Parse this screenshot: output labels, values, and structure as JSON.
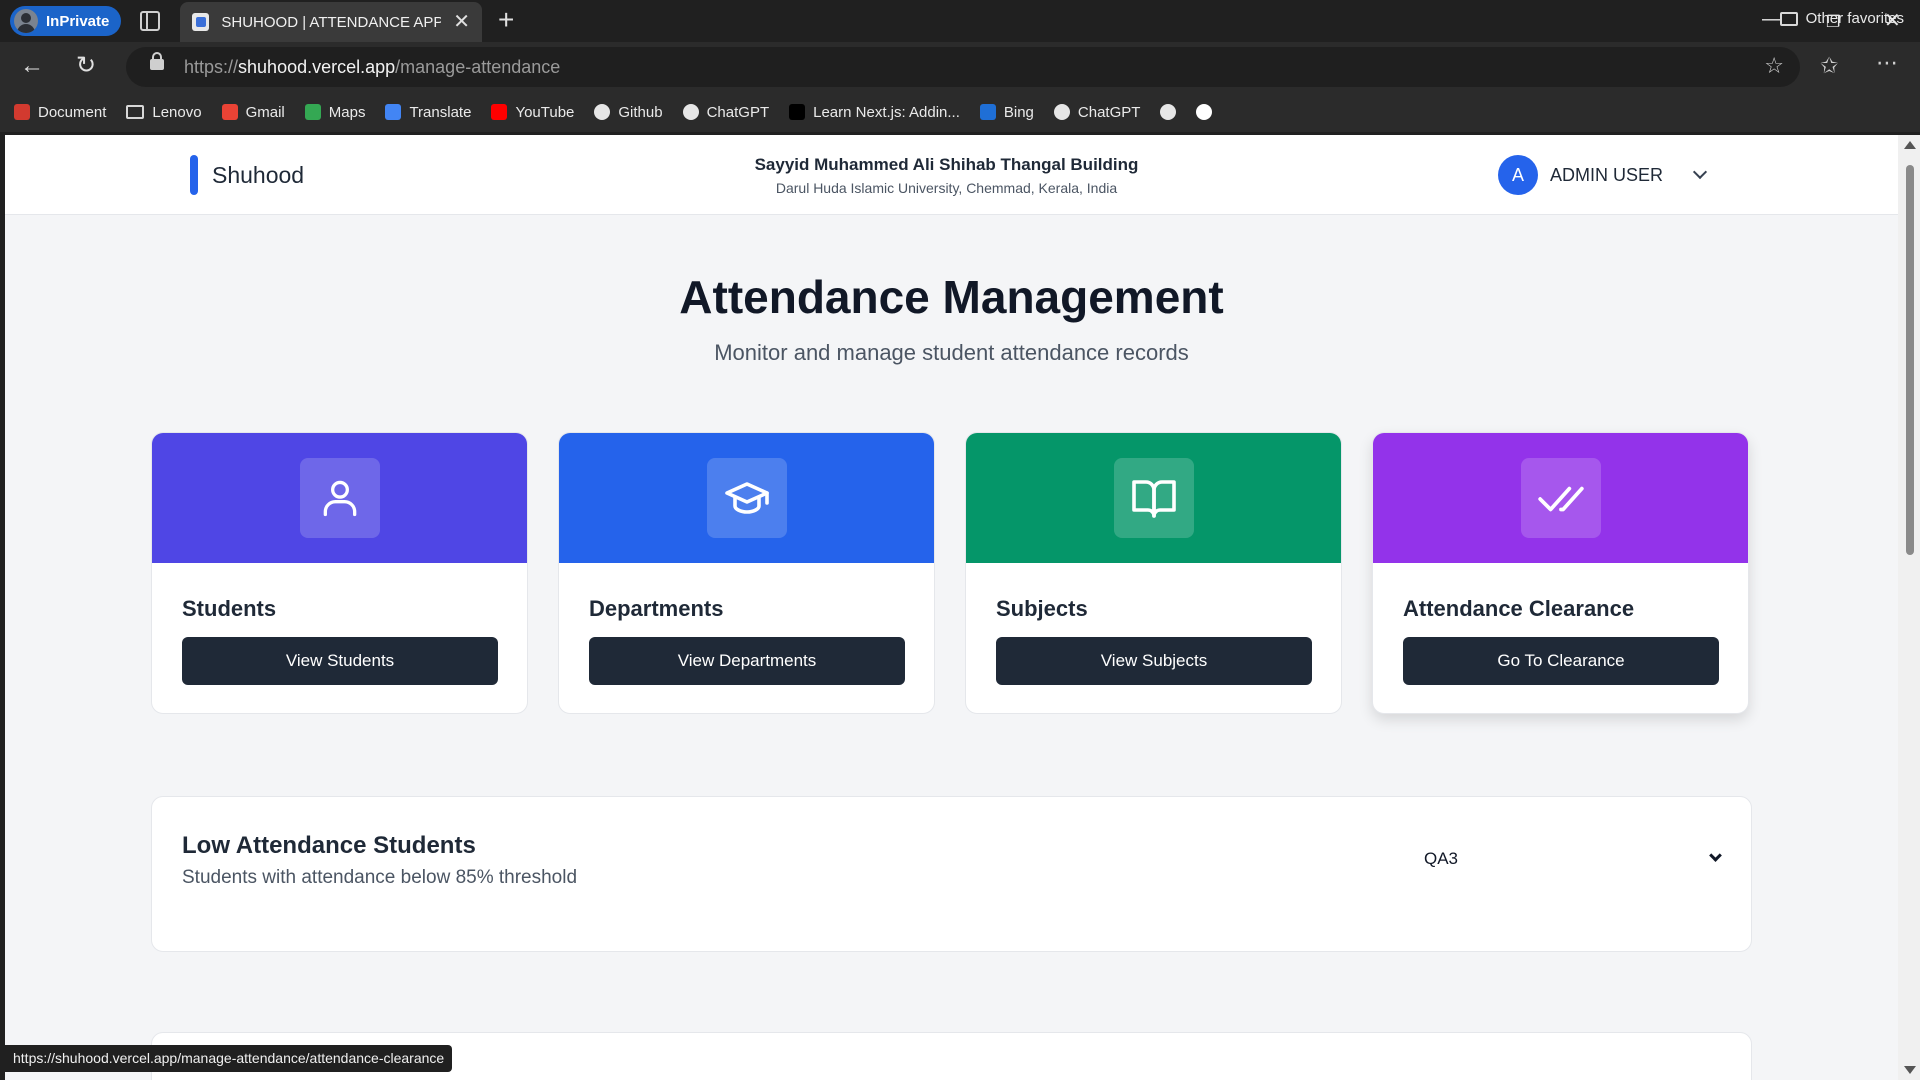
{
  "browser": {
    "inprivate_label": "InPrivate",
    "tab_title": "SHUHOOD | ATTENDANCE APPLIC",
    "url_scheme": "https://",
    "url_host": "shuhood.vercel.app",
    "url_path": "/manage-attendance",
    "bookmarks": [
      {
        "label": "Document",
        "icon": "document-icon",
        "color": "#d23a2f"
      },
      {
        "label": "Lenovo",
        "icon": "folder-icon",
        "color": "#d8d8d8"
      },
      {
        "label": "Gmail",
        "icon": "gmail-icon",
        "color": "#ea4335"
      },
      {
        "label": "Maps",
        "icon": "maps-icon",
        "color": "#34a853"
      },
      {
        "label": "Translate",
        "icon": "translate-icon",
        "color": "#4285f4"
      },
      {
        "label": "YouTube",
        "icon": "youtube-icon",
        "color": "#ff0000"
      },
      {
        "label": "Github",
        "icon": "github-icon",
        "color": "#e6e6e6"
      },
      {
        "label": "ChatGPT",
        "icon": "chatgpt-icon",
        "color": "#e6e6e6"
      },
      {
        "label": "Learn Next.js: Addin...",
        "icon": "nextjs-icon",
        "color": "#000000"
      },
      {
        "label": "Bing",
        "icon": "bing-icon",
        "color": "#1f6fd6"
      },
      {
        "label": "ChatGPT",
        "icon": "chatgpt-icon",
        "color": "#e6e6e6"
      },
      {
        "label": "",
        "icon": "github-icon",
        "color": "#e6e6e6"
      },
      {
        "label": "",
        "icon": "vercel-icon",
        "color": "#ffffff"
      }
    ],
    "other_favorites": "Other favorites",
    "status_url": "https://shuhood.vercel.app/manage-attendance/attendance-clearance"
  },
  "header": {
    "brand": "Shuhood",
    "building_name": "Sayyid Muhammed Ali Shihab Thangal Building",
    "building_address": "Darul Huda Islamic University, Chemmad, Kerala, India",
    "user_initial": "A",
    "user_name": "ADMIN USER"
  },
  "main": {
    "title": "Attendance Management",
    "subtitle": "Monitor and manage student attendance records",
    "cards": [
      {
        "label": "Students",
        "button": "View Students",
        "color": "#4f46e5",
        "icon": "user-icon"
      },
      {
        "label": "Departments",
        "button": "View Departments",
        "color": "#2563eb",
        "icon": "graduation-cap-icon"
      },
      {
        "label": "Subjects",
        "button": "View Subjects",
        "color": "#059669",
        "icon": "book-open-icon"
      },
      {
        "label": "Attendance Clearance",
        "button": "Go To Clearance",
        "color": "#9333ea",
        "icon": "double-check-icon"
      }
    ]
  },
  "low_attendance": {
    "title": "Low Attendance Students",
    "subtitle": "Students with attendance below 85% threshold",
    "selected_class": "QA3"
  }
}
